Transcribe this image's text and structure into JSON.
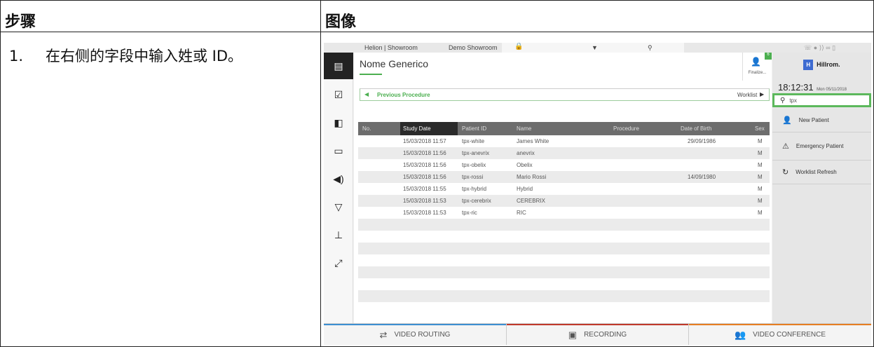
{
  "table_headers": {
    "step": "步骤",
    "image": "图像"
  },
  "step": {
    "number": "1.",
    "text": "在右侧的字段中输入姓或 ID。"
  },
  "topbar": {
    "site": "Helion | Showroom",
    "room": "Demo Showroom"
  },
  "patient": {
    "name": "Nome Generico",
    "finalize": "Finalize...",
    "badge": "6"
  },
  "nav": {
    "previous": "Previous Procedure",
    "worklist": "Worklist"
  },
  "columns": [
    "No.",
    "Study Date",
    "Patient ID",
    "Name",
    "Procedure",
    "Date of Birth",
    "Sex"
  ],
  "rows": [
    {
      "date": "15/03/2018 11:57",
      "id": "tpx-white",
      "name": "James White",
      "dob": "29/09/1986",
      "sex": "M"
    },
    {
      "date": "15/03/2018 11:56",
      "id": "tpx-anevrix",
      "name": "anevrix",
      "dob": "",
      "sex": "M"
    },
    {
      "date": "15/03/2018 11:56",
      "id": "tpx-obelix",
      "name": "Obelix",
      "dob": "",
      "sex": "M"
    },
    {
      "date": "15/03/2018 11:56",
      "id": "tpx-rossi",
      "name": "Mario Rossi",
      "dob": "14/09/1980",
      "sex": "M"
    },
    {
      "date": "15/03/2018 11:55",
      "id": "tpx-hybrid",
      "name": "Hybrid",
      "dob": "",
      "sex": "M"
    },
    {
      "date": "15/03/2018 11:53",
      "id": "tpx-cerebrix",
      "name": "CEREBRIX",
      "dob": "",
      "sex": "M"
    },
    {
      "date": "15/03/2018 11:53",
      "id": "tpx-ric",
      "name": "RIC",
      "dob": "",
      "sex": "M"
    }
  ],
  "right": {
    "brand": "Hillrom.",
    "time": "18:12:31",
    "date": "Mon 05/11/2018",
    "search_value": "tpx",
    "new_patient": "New Patient",
    "emergency": "Emergency Patient",
    "refresh": "Worklist Refresh"
  },
  "bottom": {
    "routing": "VIDEO ROUTING",
    "recording": "RECORDING",
    "conference": "VIDEO CONFERENCE"
  },
  "colors": {
    "accent_green": "#4caf50",
    "brand_blue": "#3d6bd1",
    "search_highlight": "#5cb85c"
  }
}
